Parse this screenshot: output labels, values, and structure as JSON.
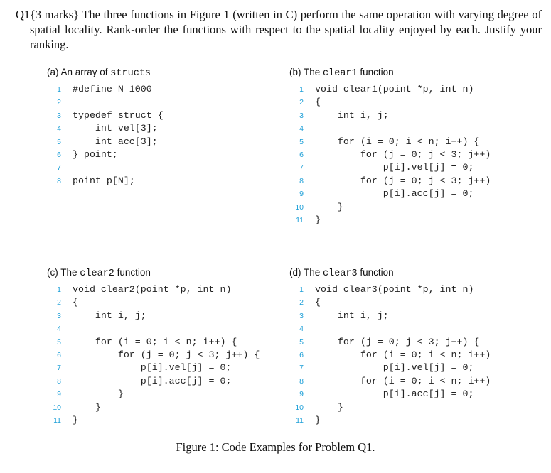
{
  "question": {
    "number": "Q1",
    "text": "{3 marks} The three functions in Figure 1 (written in C) perform the same operation with varying degree of spatial locality. Rank-order the functions with respect to the spatial locality enjoyed by each. Justify your ranking."
  },
  "panels": [
    {
      "label_prefix": "(a) An array of ",
      "label_code": "structs",
      "label_suffix": "",
      "lines": [
        {
          "n": "1",
          "code": "#define N 1000"
        },
        {
          "n": "2",
          "code": ""
        },
        {
          "n": "3",
          "code": "typedef struct {"
        },
        {
          "n": "4",
          "code": "    int vel[3];"
        },
        {
          "n": "5",
          "code": "    int acc[3];"
        },
        {
          "n": "6",
          "code": "} point;"
        },
        {
          "n": "7",
          "code": ""
        },
        {
          "n": "8",
          "code": "point p[N];"
        }
      ]
    },
    {
      "label_prefix": "(b) The ",
      "label_code": "clear1",
      "label_suffix": " function",
      "lines": [
        {
          "n": "1",
          "code": "void clear1(point *p, int n)"
        },
        {
          "n": "2",
          "code": "{"
        },
        {
          "n": "3",
          "code": "    int i, j;"
        },
        {
          "n": "4",
          "code": ""
        },
        {
          "n": "5",
          "code": "    for (i = 0; i < n; i++) {"
        },
        {
          "n": "6",
          "code": "        for (j = 0; j < 3; j++)"
        },
        {
          "n": "7",
          "code": "            p[i].vel[j] = 0;"
        },
        {
          "n": "8",
          "code": "        for (j = 0; j < 3; j++)"
        },
        {
          "n": "9",
          "code": "            p[i].acc[j] = 0;"
        },
        {
          "n": "10",
          "code": "    }"
        },
        {
          "n": "11",
          "code": "}"
        }
      ]
    },
    {
      "label_prefix": "(c) The ",
      "label_code": "clear2",
      "label_suffix": " function",
      "lines": [
        {
          "n": "1",
          "code": "void clear2(point *p, int n)"
        },
        {
          "n": "2",
          "code": "{"
        },
        {
          "n": "3",
          "code": "    int i, j;"
        },
        {
          "n": "4",
          "code": ""
        },
        {
          "n": "5",
          "code": "    for (i = 0; i < n; i++) {"
        },
        {
          "n": "6",
          "code": "        for (j = 0; j < 3; j++) {"
        },
        {
          "n": "7",
          "code": "            p[i].vel[j] = 0;"
        },
        {
          "n": "8",
          "code": "            p[i].acc[j] = 0;"
        },
        {
          "n": "9",
          "code": "        }"
        },
        {
          "n": "10",
          "code": "    }"
        },
        {
          "n": "11",
          "code": "}"
        }
      ]
    },
    {
      "label_prefix": "(d) The ",
      "label_code": "clear3",
      "label_suffix": " function",
      "lines": [
        {
          "n": "1",
          "code": "void clear3(point *p, int n)"
        },
        {
          "n": "2",
          "code": "{"
        },
        {
          "n": "3",
          "code": "    int i, j;"
        },
        {
          "n": "4",
          "code": ""
        },
        {
          "n": "5",
          "code": "    for (j = 0; j < 3; j++) {"
        },
        {
          "n": "6",
          "code": "        for (i = 0; i < n; i++)"
        },
        {
          "n": "7",
          "code": "            p[i].vel[j] = 0;"
        },
        {
          "n": "8",
          "code": "        for (i = 0; i < n; i++)"
        },
        {
          "n": "9",
          "code": "            p[i].acc[j] = 0;"
        },
        {
          "n": "10",
          "code": "    }"
        },
        {
          "n": "11",
          "code": "}"
        }
      ]
    }
  ],
  "caption": "Figure 1: Code Examples for Problem Q1.",
  "colors": {
    "line_number": "#1fa0d8",
    "text": "#111111"
  }
}
